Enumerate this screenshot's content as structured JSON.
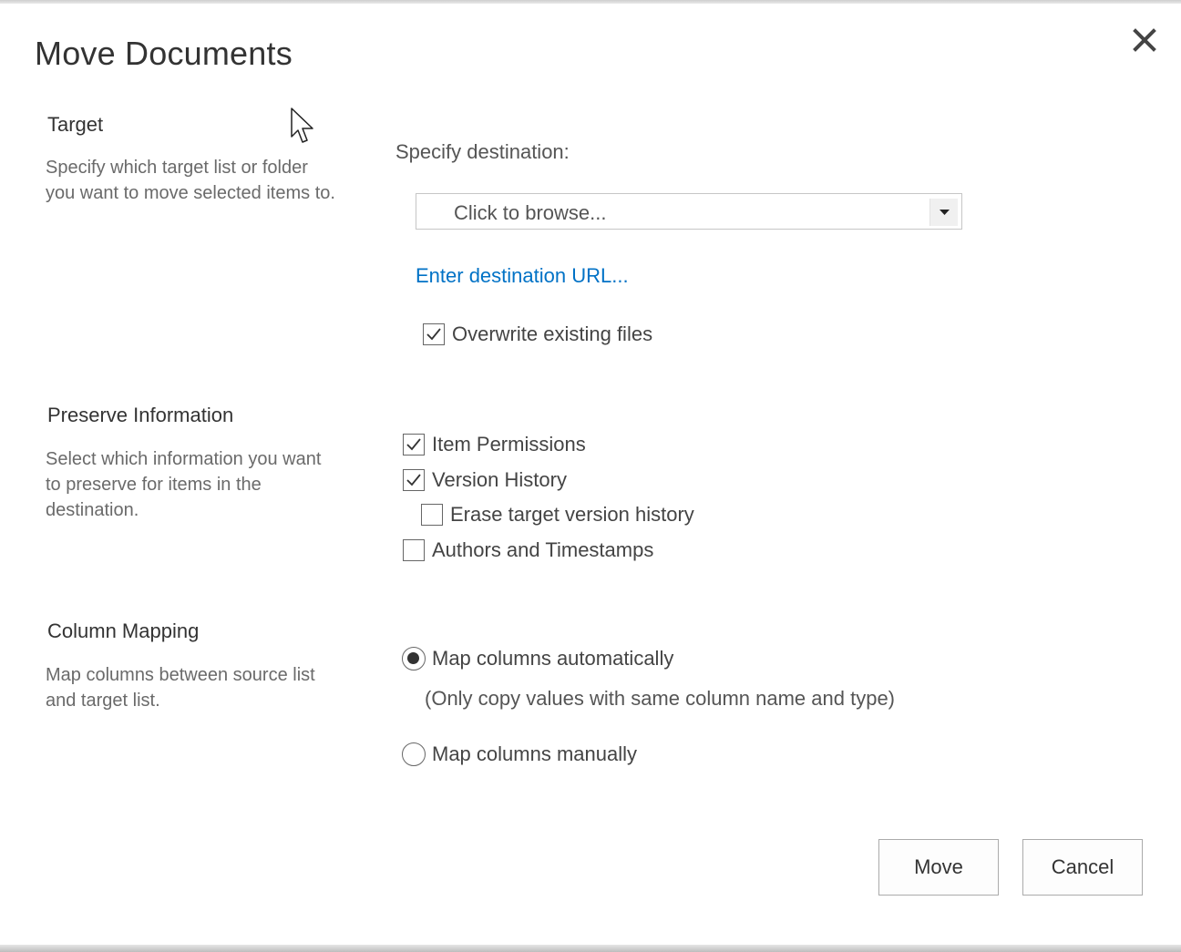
{
  "dialog": {
    "title": "Move Documents",
    "close_icon": "close-icon"
  },
  "target": {
    "title": "Target",
    "description": "Specify which target list or folder you want to move selected items to.",
    "destination_label": "Specify destination:",
    "browse_placeholder": "Click to browse...",
    "url_link": "Enter destination URL...",
    "overwrite": {
      "label": "Overwrite existing files",
      "checked": true
    }
  },
  "preserve": {
    "title": "Preserve Information",
    "description": "Select which information you want to preserve for items in the destination.",
    "options": [
      {
        "label": "Item Permissions",
        "checked": true
      },
      {
        "label": "Version History",
        "checked": true
      },
      {
        "label": "Erase target version history",
        "checked": false
      },
      {
        "label": "Authors and Timestamps",
        "checked": false
      }
    ]
  },
  "mapping": {
    "title": "Column Mapping",
    "description": "Map columns between source list and target list.",
    "auto": {
      "label": "Map columns automatically",
      "selected": true
    },
    "auto_note": "(Only copy values with same column name and type)",
    "manual": {
      "label": "Map columns manually",
      "selected": false
    }
  },
  "buttons": {
    "move": "Move",
    "cancel": "Cancel"
  },
  "colors": {
    "link": "#0072c6",
    "text": "#333333",
    "muted": "#6a6a6a"
  }
}
